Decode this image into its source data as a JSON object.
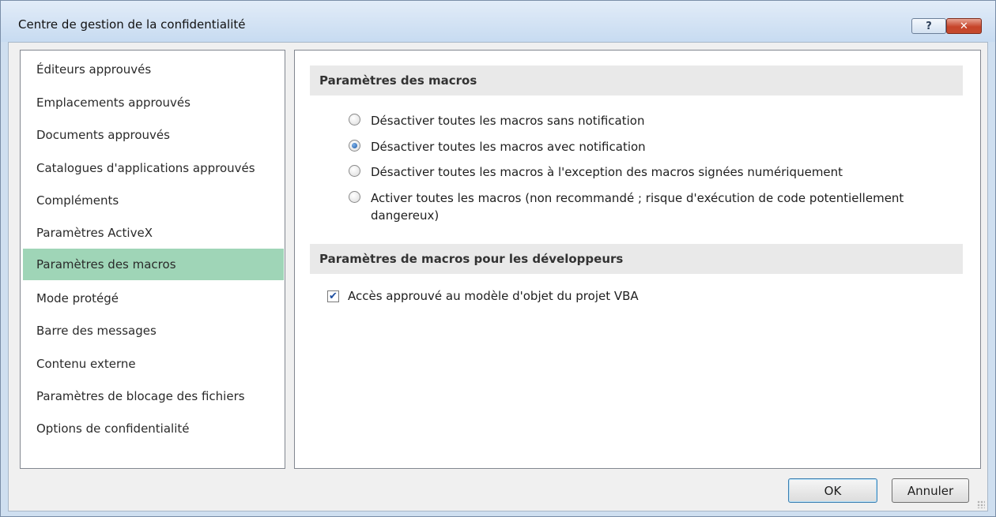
{
  "window": {
    "title": "Centre de gestion de la confidentialité",
    "help_label": "?",
    "close_label": "✕"
  },
  "sidebar": {
    "items": [
      {
        "label": "Éditeurs approuvés"
      },
      {
        "label": "Emplacements approuvés"
      },
      {
        "label": "Documents approuvés"
      },
      {
        "label": "Catalogues d'applications approuvés"
      },
      {
        "label": "Compléments"
      },
      {
        "label": "Paramètres ActiveX"
      },
      {
        "label": "Paramètres des macros",
        "selected": true
      },
      {
        "label": "Mode protégé"
      },
      {
        "label": "Barre des messages"
      },
      {
        "label": "Contenu externe"
      },
      {
        "label": "Paramètres de blocage des fichiers"
      },
      {
        "label": "Options de confidentialité"
      }
    ]
  },
  "macros": {
    "header": "Paramètres des macros",
    "options": [
      {
        "label": "Désactiver toutes les macros sans notification",
        "checked": false
      },
      {
        "label": "Désactiver toutes les macros avec notification",
        "checked": true
      },
      {
        "label": "Désactiver toutes les macros à l'exception des macros signées numériquement",
        "checked": false
      },
      {
        "label": "Activer toutes les macros (non recommandé ; risque d'exécution de code potentiellement dangereux)",
        "checked": false
      }
    ]
  },
  "developer": {
    "header": "Paramètres de macros pour les développeurs",
    "vba_access_label": "Accès approuvé au modèle d'objet du projet VBA",
    "vba_access_checked": true
  },
  "buttons": {
    "ok_label": "OK",
    "cancel_label": "Annuler"
  },
  "colors": {
    "selected_item": "#9fd5b7",
    "title_bar": "#c7dbf1",
    "close_button": "#c6442a"
  }
}
